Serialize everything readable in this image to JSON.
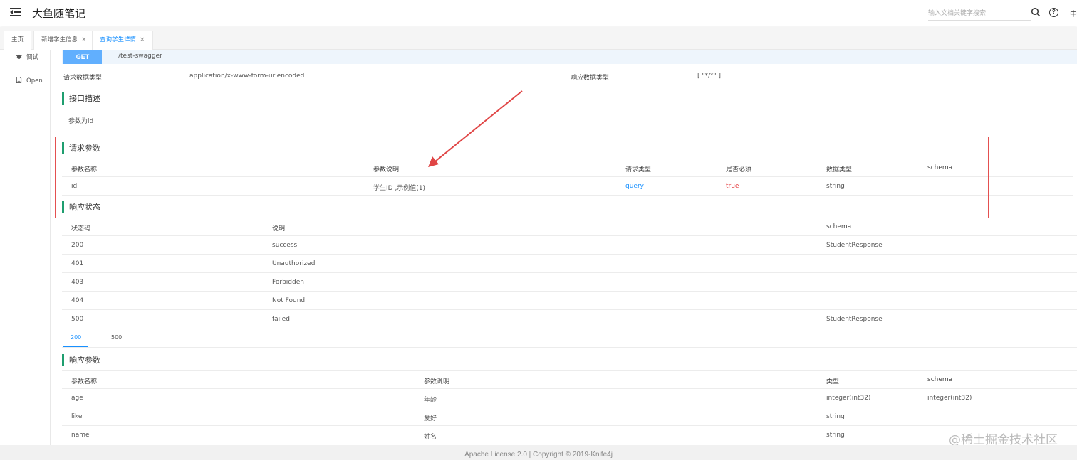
{
  "app": {
    "title": "大鱼随笔记",
    "lang": "中"
  },
  "search": {
    "placeholder": "输入文档关键字搜索"
  },
  "tabs": [
    {
      "label": "主页",
      "closable": false,
      "active": false
    },
    {
      "label": "新增学生信息",
      "closable": true,
      "active": false
    },
    {
      "label": "查询学生详情",
      "closable": true,
      "active": true
    }
  ],
  "close_glyph": "×",
  "sidebar": {
    "items": [
      {
        "label": "调试",
        "icon": "bug-icon"
      },
      {
        "label": "Open",
        "icon": "document-icon"
      }
    ]
  },
  "endpoint": {
    "method": "GET",
    "path": "/test-swagger"
  },
  "meta": {
    "request_type_label": "请求数据类型",
    "request_type_value": "application/x-www-form-urlencoded",
    "response_type_label": "响应数据类型",
    "response_type_value": "[ \"*/*\" ]"
  },
  "description": {
    "title": "接口描述",
    "text": "参数为id"
  },
  "request_params": {
    "title": "请求参数",
    "headers": [
      "参数名称",
      "参数说明",
      "请求类型",
      "是否必须",
      "数据类型",
      "schema"
    ],
    "rows": [
      {
        "name": "id",
        "desc": "学生ID ,示例值(1)",
        "in": "query",
        "required": "true",
        "type": "string",
        "schema": ""
      }
    ]
  },
  "response_status": {
    "title": "响应状态",
    "headers": [
      "状态码",
      "说明",
      "schema"
    ],
    "rows": [
      {
        "code": "200",
        "desc": "success",
        "schema": "StudentResponse"
      },
      {
        "code": "401",
        "desc": "Unauthorized",
        "schema": ""
      },
      {
        "code": "403",
        "desc": "Forbidden",
        "schema": ""
      },
      {
        "code": "404",
        "desc": "Not Found",
        "schema": ""
      },
      {
        "code": "500",
        "desc": "failed",
        "schema": "StudentResponse"
      }
    ]
  },
  "response_tabs": [
    "200",
    "500"
  ],
  "response_params": {
    "title": "响应参数",
    "headers": [
      "参数名称",
      "参数说明",
      "类型",
      "schema"
    ],
    "rows": [
      {
        "name": "age",
        "desc": "年龄",
        "type": "integer(int32)",
        "schema": "integer(int32)"
      },
      {
        "name": "like",
        "desc": "爱好",
        "type": "string",
        "schema": ""
      },
      {
        "name": "name",
        "desc": "姓名",
        "type": "string",
        "schema": ""
      }
    ]
  },
  "footer": {
    "text": "Apache License 2.0 | Copyright © 2019-Knife4j"
  },
  "watermark": "@稀土掘金技术社区",
  "colors": {
    "accent": "#1890ff",
    "get": "#61affe",
    "section_bar": "#1e9e6f",
    "required": "#e4393c",
    "annotation": "#e45050"
  }
}
